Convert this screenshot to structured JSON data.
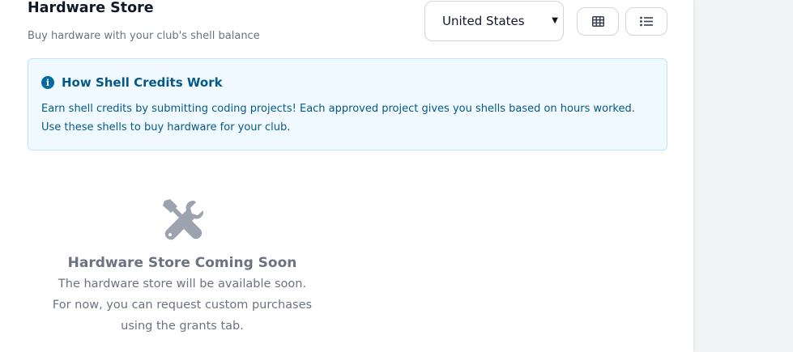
{
  "header": {
    "title": "Hardware Store",
    "subtitle": "Buy hardware with your club's shell balance"
  },
  "controls": {
    "country_selected": "United States",
    "grid_view_icon": "grid-icon",
    "list_view_icon": "list-icon"
  },
  "info": {
    "icon": "info-icon",
    "title": "How Shell Credits Work",
    "text": "Earn shell credits by submitting coding projects! Each approved project gives you shells based on hours worked. Use these shells to buy hardware for your club."
  },
  "empty_state": {
    "icon": "tools-icon",
    "title": "Hardware Store Coming Soon",
    "lines": [
      "The hardware store will be available soon.",
      "For now, you can request custom purchases",
      "using the grants tab."
    ]
  },
  "colors": {
    "info_background": "#f0f9ff",
    "info_border": "#bae6fd",
    "info_text": "#075985",
    "muted_text": "#6b7280",
    "icon_gray": "#9ca3af"
  }
}
